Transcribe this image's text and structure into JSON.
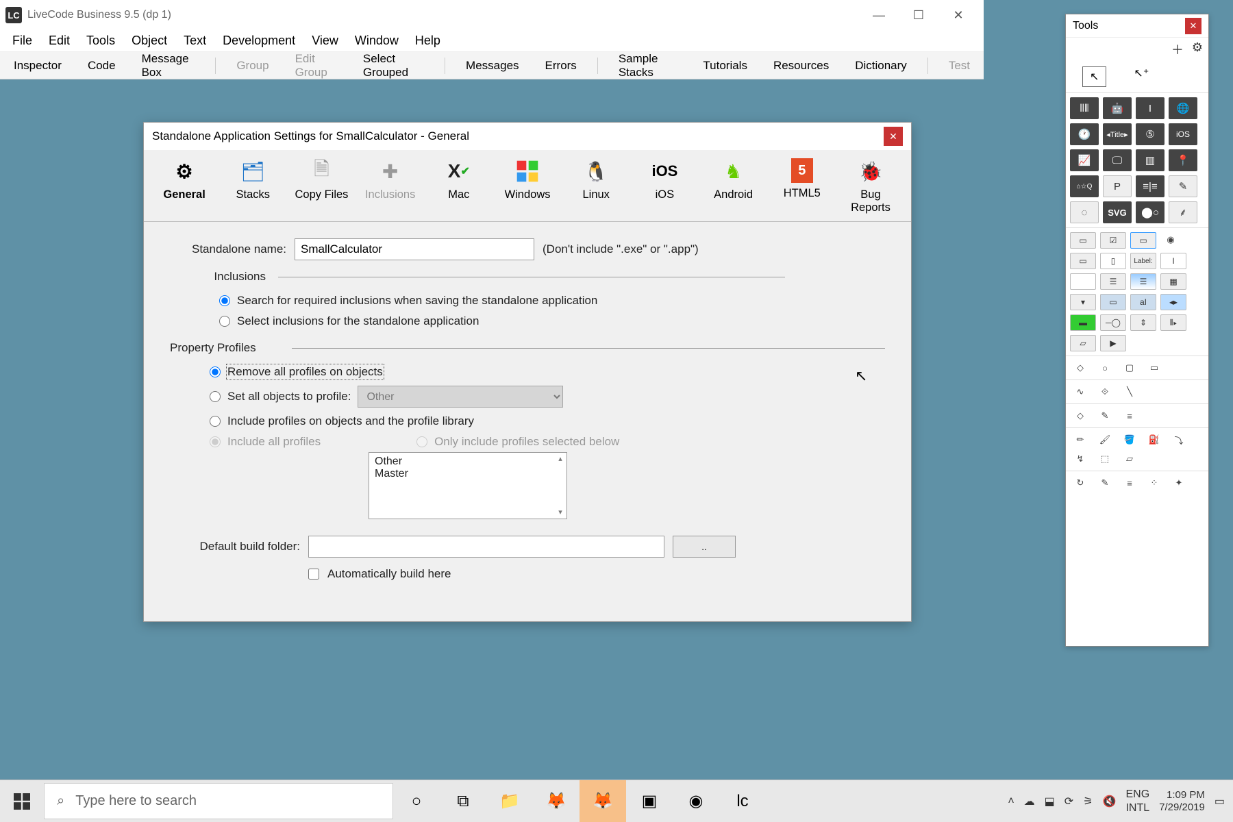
{
  "app": {
    "title": "LiveCode Business 9.5 (dp 1)"
  },
  "menubar": [
    "File",
    "Edit",
    "Tools",
    "Object",
    "Text",
    "Development",
    "View",
    "Window",
    "Help"
  ],
  "toolbar": {
    "items": [
      "Inspector",
      "Code",
      "Message Box"
    ],
    "disabled1": "Group",
    "disabled2": "Edit Group",
    "item4": "Select Grouped",
    "item5": "Messages",
    "item6": "Errors",
    "item7": "Sample Stacks",
    "item8": "Tutorials",
    "item9": "Resources",
    "item10": "Dictionary",
    "disabled3": "Test"
  },
  "dialog": {
    "title": "Standalone Application Settings for SmallCalculator - General",
    "tabs": [
      {
        "label": "General",
        "glyph": "⚙"
      },
      {
        "label": "Stacks",
        "glyph": "🗂"
      },
      {
        "label": "Copy Files",
        "glyph": "📄"
      },
      {
        "label": "Inclusions",
        "glyph": "🧩",
        "disabled": true
      },
      {
        "label": "Mac",
        "glyph": "✕"
      },
      {
        "label": "Windows",
        "glyph": "⊞"
      },
      {
        "label": "Linux",
        "glyph": "🐧"
      },
      {
        "label": "iOS",
        "glyph": "iOS"
      },
      {
        "label": "Android",
        "glyph": "🤖"
      },
      {
        "label": "HTML5",
        "glyph": "5"
      },
      {
        "label": "Bug Reports",
        "glyph": "🐞"
      }
    ],
    "name_label": "Standalone name:",
    "name_value": "SmallCalculator",
    "name_hint": "(Don't include \".exe\" or \".app\")",
    "inclusions_head": "Inclusions",
    "incl_r1": "Search for required inclusions when saving the standalone application",
    "incl_r2": "Select inclusions for the standalone application",
    "profiles_head": "Property Profiles",
    "prof_r1": "Remove all profiles on objects",
    "prof_r2": "Set all objects to profile:",
    "prof_r2_value": "Other",
    "prof_r3": "Include profiles on objects and the profile library",
    "prof_r4a": "Include all profiles",
    "prof_r4b": "Only include profiles selected below",
    "profiles_list": [
      "Other",
      "Master"
    ],
    "build_label": "Default build folder:",
    "build_value": "",
    "browse_label": "..",
    "auto_build": "Automatically build here"
  },
  "tools": {
    "title": "Tools"
  },
  "taskbar": {
    "search_placeholder": "Type here to search",
    "lang1": "ENG",
    "lang2": "INTL",
    "time": "1:09 PM",
    "date": "7/29/2019"
  }
}
